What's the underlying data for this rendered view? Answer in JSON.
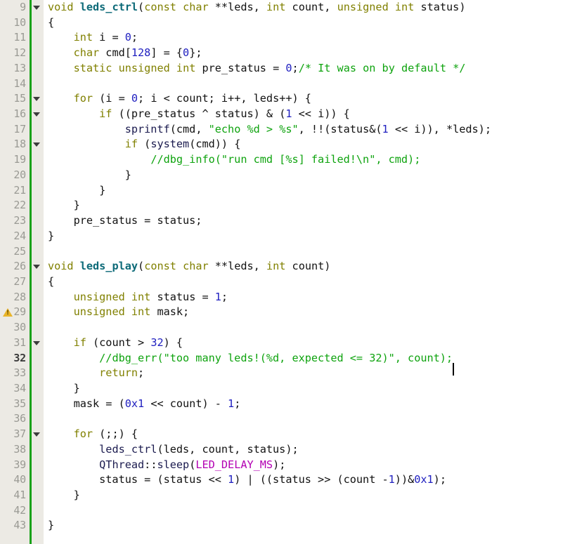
{
  "editor": {
    "first_line": 9,
    "last_line": 43,
    "current_line": 32,
    "warning_lines": [
      29
    ],
    "fold_lines": [
      9,
      15,
      16,
      18,
      26,
      31,
      37
    ],
    "change_bar_color": "#19a219",
    "gutter_bg": "#eceae4",
    "code_bg": "#ffffff",
    "colors": {
      "keyword": "#808000",
      "function_def": "#0c6a78",
      "identifier": "#1a1a4e",
      "number": "#2020c0",
      "string": "#0ea30e",
      "comment": "#0ea30e",
      "macro": "#b300b3",
      "lineno": "#9a9a94",
      "lineno_current": "#3c3c3c",
      "warning_icon": "#e9b52a"
    },
    "icons": {
      "fold": "triangle-down-icon",
      "warning": "warning-triangle-icon",
      "caret": "text-caret"
    }
  },
  "lines": [
    {
      "n": 9,
      "fold": true,
      "warn": false,
      "tokens": [
        {
          "t": "void",
          "c": "kw"
        },
        {
          "t": " ",
          "c": "op"
        },
        {
          "t": "leds_ctrl",
          "c": "fn"
        },
        {
          "t": "(",
          "c": "op"
        },
        {
          "t": "const",
          "c": "kw"
        },
        {
          "t": " ",
          "c": "op"
        },
        {
          "t": "char",
          "c": "kw"
        },
        {
          "t": " **",
          "c": "op"
        },
        {
          "t": "leds",
          "c": "id"
        },
        {
          "t": ", ",
          "c": "op"
        },
        {
          "t": "int",
          "c": "kw"
        },
        {
          "t": " ",
          "c": "op"
        },
        {
          "t": "count",
          "c": "id"
        },
        {
          "t": ", ",
          "c": "op"
        },
        {
          "t": "unsigned",
          "c": "kw"
        },
        {
          "t": " ",
          "c": "op"
        },
        {
          "t": "int",
          "c": "kw"
        },
        {
          "t": " ",
          "c": "op"
        },
        {
          "t": "status",
          "c": "id"
        },
        {
          "t": ")",
          "c": "op"
        }
      ]
    },
    {
      "n": 10,
      "fold": false,
      "warn": false,
      "tokens": [
        {
          "t": "{",
          "c": "op"
        }
      ]
    },
    {
      "n": 11,
      "fold": false,
      "warn": false,
      "tokens": [
        {
          "t": "    ",
          "c": "op"
        },
        {
          "t": "int",
          "c": "kw"
        },
        {
          "t": " i = ",
          "c": "op"
        },
        {
          "t": "0",
          "c": "num"
        },
        {
          "t": ";",
          "c": "op"
        }
      ]
    },
    {
      "n": 12,
      "fold": false,
      "warn": false,
      "tokens": [
        {
          "t": "    ",
          "c": "op"
        },
        {
          "t": "char",
          "c": "kw"
        },
        {
          "t": " cmd[",
          "c": "op"
        },
        {
          "t": "128",
          "c": "num"
        },
        {
          "t": "] = {",
          "c": "op"
        },
        {
          "t": "0",
          "c": "num"
        },
        {
          "t": "};",
          "c": "op"
        }
      ]
    },
    {
      "n": 13,
      "fold": false,
      "warn": false,
      "tokens": [
        {
          "t": "    ",
          "c": "op"
        },
        {
          "t": "static",
          "c": "kw"
        },
        {
          "t": " ",
          "c": "op"
        },
        {
          "t": "unsigned",
          "c": "kw"
        },
        {
          "t": " ",
          "c": "op"
        },
        {
          "t": "int",
          "c": "kw"
        },
        {
          "t": " pre_status = ",
          "c": "op"
        },
        {
          "t": "0",
          "c": "num"
        },
        {
          "t": ";",
          "c": "op"
        },
        {
          "t": "/* It was on by default */",
          "c": "cmt"
        }
      ]
    },
    {
      "n": 14,
      "fold": false,
      "warn": false,
      "tokens": [
        {
          "t": "",
          "c": "op"
        }
      ]
    },
    {
      "n": 15,
      "fold": true,
      "warn": false,
      "tokens": [
        {
          "t": "    ",
          "c": "op"
        },
        {
          "t": "for",
          "c": "kw"
        },
        {
          "t": " (i = ",
          "c": "op"
        },
        {
          "t": "0",
          "c": "num"
        },
        {
          "t": "; i < count; i++, leds++) {",
          "c": "op"
        }
      ]
    },
    {
      "n": 16,
      "fold": true,
      "warn": false,
      "tokens": [
        {
          "t": "        ",
          "c": "op"
        },
        {
          "t": "if",
          "c": "kw"
        },
        {
          "t": " ((pre_status ^ status) & (",
          "c": "op"
        },
        {
          "t": "1",
          "c": "num"
        },
        {
          "t": " << i)) {",
          "c": "op"
        }
      ]
    },
    {
      "n": 17,
      "fold": false,
      "warn": false,
      "tokens": [
        {
          "t": "            ",
          "c": "op"
        },
        {
          "t": "sprintf",
          "c": "fnc"
        },
        {
          "t": "(cmd, ",
          "c": "op"
        },
        {
          "t": "\"echo %d > %s\"",
          "c": "str"
        },
        {
          "t": ", !!(status&(",
          "c": "op"
        },
        {
          "t": "1",
          "c": "num"
        },
        {
          "t": " << i)), *leds);",
          "c": "op"
        }
      ]
    },
    {
      "n": 18,
      "fold": true,
      "warn": false,
      "tokens": [
        {
          "t": "            ",
          "c": "op"
        },
        {
          "t": "if",
          "c": "kw"
        },
        {
          "t": " (",
          "c": "op"
        },
        {
          "t": "system",
          "c": "fnc"
        },
        {
          "t": "(cmd)) {",
          "c": "op"
        }
      ]
    },
    {
      "n": 19,
      "fold": false,
      "warn": false,
      "tokens": [
        {
          "t": "                ",
          "c": "op"
        },
        {
          "t": "//dbg_info(\"run cmd [%s] failed!\\n\", cmd);",
          "c": "cmt"
        }
      ]
    },
    {
      "n": 20,
      "fold": false,
      "warn": false,
      "tokens": [
        {
          "t": "            }",
          "c": "op"
        }
      ]
    },
    {
      "n": 21,
      "fold": false,
      "warn": false,
      "tokens": [
        {
          "t": "        }",
          "c": "op"
        }
      ]
    },
    {
      "n": 22,
      "fold": false,
      "warn": false,
      "tokens": [
        {
          "t": "    }",
          "c": "op"
        }
      ]
    },
    {
      "n": 23,
      "fold": false,
      "warn": false,
      "tokens": [
        {
          "t": "    pre_status = status;",
          "c": "op"
        }
      ]
    },
    {
      "n": 24,
      "fold": false,
      "warn": false,
      "tokens": [
        {
          "t": "}",
          "c": "op"
        }
      ]
    },
    {
      "n": 25,
      "fold": false,
      "warn": false,
      "tokens": [
        {
          "t": "",
          "c": "op"
        }
      ]
    },
    {
      "n": 26,
      "fold": true,
      "warn": false,
      "tokens": [
        {
          "t": "void",
          "c": "kw"
        },
        {
          "t": " ",
          "c": "op"
        },
        {
          "t": "leds_play",
          "c": "fn"
        },
        {
          "t": "(",
          "c": "op"
        },
        {
          "t": "const",
          "c": "kw"
        },
        {
          "t": " ",
          "c": "op"
        },
        {
          "t": "char",
          "c": "kw"
        },
        {
          "t": " **",
          "c": "op"
        },
        {
          "t": "leds",
          "c": "id"
        },
        {
          "t": ", ",
          "c": "op"
        },
        {
          "t": "int",
          "c": "kw"
        },
        {
          "t": " ",
          "c": "op"
        },
        {
          "t": "count",
          "c": "id"
        },
        {
          "t": ")",
          "c": "op"
        }
      ]
    },
    {
      "n": 27,
      "fold": false,
      "warn": false,
      "tokens": [
        {
          "t": "{",
          "c": "op"
        }
      ]
    },
    {
      "n": 28,
      "fold": false,
      "warn": false,
      "tokens": [
        {
          "t": "    ",
          "c": "op"
        },
        {
          "t": "unsigned",
          "c": "kw"
        },
        {
          "t": " ",
          "c": "op"
        },
        {
          "t": "int",
          "c": "kw"
        },
        {
          "t": " status = ",
          "c": "op"
        },
        {
          "t": "1",
          "c": "num"
        },
        {
          "t": ";",
          "c": "op"
        }
      ]
    },
    {
      "n": 29,
      "fold": false,
      "warn": true,
      "tokens": [
        {
          "t": "    ",
          "c": "op"
        },
        {
          "t": "unsigned",
          "c": "kw"
        },
        {
          "t": " ",
          "c": "op"
        },
        {
          "t": "int",
          "c": "kw"
        },
        {
          "t": " mask;",
          "c": "op"
        }
      ]
    },
    {
      "n": 30,
      "fold": false,
      "warn": false,
      "tokens": [
        {
          "t": "",
          "c": "op"
        }
      ]
    },
    {
      "n": 31,
      "fold": true,
      "warn": false,
      "tokens": [
        {
          "t": "    ",
          "c": "op"
        },
        {
          "t": "if",
          "c": "kw"
        },
        {
          "t": " (count > ",
          "c": "op"
        },
        {
          "t": "32",
          "c": "num"
        },
        {
          "t": ") {",
          "c": "op"
        }
      ]
    },
    {
      "n": 32,
      "fold": false,
      "warn": false,
      "current": true,
      "caret": true,
      "tokens": [
        {
          "t": "        ",
          "c": "op"
        },
        {
          "t": "//dbg_err(\"too many leds!(%d, expected <= 32)\", count);",
          "c": "cmt"
        }
      ]
    },
    {
      "n": 33,
      "fold": false,
      "warn": false,
      "tokens": [
        {
          "t": "        ",
          "c": "op"
        },
        {
          "t": "return",
          "c": "kw"
        },
        {
          "t": ";",
          "c": "op"
        }
      ]
    },
    {
      "n": 34,
      "fold": false,
      "warn": false,
      "tokens": [
        {
          "t": "    }",
          "c": "op"
        }
      ]
    },
    {
      "n": 35,
      "fold": false,
      "warn": false,
      "tokens": [
        {
          "t": "    mask = (",
          "c": "op"
        },
        {
          "t": "0x1",
          "c": "num"
        },
        {
          "t": " << count) - ",
          "c": "op"
        },
        {
          "t": "1",
          "c": "num"
        },
        {
          "t": ";",
          "c": "op"
        }
      ]
    },
    {
      "n": 36,
      "fold": false,
      "warn": false,
      "tokens": [
        {
          "t": "",
          "c": "op"
        }
      ]
    },
    {
      "n": 37,
      "fold": true,
      "warn": false,
      "tokens": [
        {
          "t": "    ",
          "c": "op"
        },
        {
          "t": "for",
          "c": "kw"
        },
        {
          "t": " (;;) {",
          "c": "op"
        }
      ]
    },
    {
      "n": 38,
      "fold": false,
      "warn": false,
      "tokens": [
        {
          "t": "        ",
          "c": "op"
        },
        {
          "t": "leds_ctrl",
          "c": "fnc"
        },
        {
          "t": "(leds, count, status);",
          "c": "op"
        }
      ]
    },
    {
      "n": 39,
      "fold": false,
      "warn": false,
      "tokens": [
        {
          "t": "        ",
          "c": "op"
        },
        {
          "t": "QThread",
          "c": "cls"
        },
        {
          "t": "::",
          "c": "op"
        },
        {
          "t": "sleep",
          "c": "fnc"
        },
        {
          "t": "(",
          "c": "op"
        },
        {
          "t": "LED_DELAY_MS",
          "c": "mac"
        },
        {
          "t": ");",
          "c": "op"
        }
      ]
    },
    {
      "n": 40,
      "fold": false,
      "warn": false,
      "tokens": [
        {
          "t": "        status = (status << ",
          "c": "op"
        },
        {
          "t": "1",
          "c": "num"
        },
        {
          "t": ") | ((status >> (count -",
          "c": "op"
        },
        {
          "t": "1",
          "c": "num"
        },
        {
          "t": "))&",
          "c": "op"
        },
        {
          "t": "0x1",
          "c": "num"
        },
        {
          "t": ");",
          "c": "op"
        }
      ]
    },
    {
      "n": 41,
      "fold": false,
      "warn": false,
      "tokens": [
        {
          "t": "    }",
          "c": "op"
        }
      ]
    },
    {
      "n": 42,
      "fold": false,
      "warn": false,
      "tokens": [
        {
          "t": "",
          "c": "op"
        }
      ]
    },
    {
      "n": 43,
      "fold": false,
      "warn": false,
      "tokens": [
        {
          "t": "}",
          "c": "op"
        }
      ]
    }
  ]
}
